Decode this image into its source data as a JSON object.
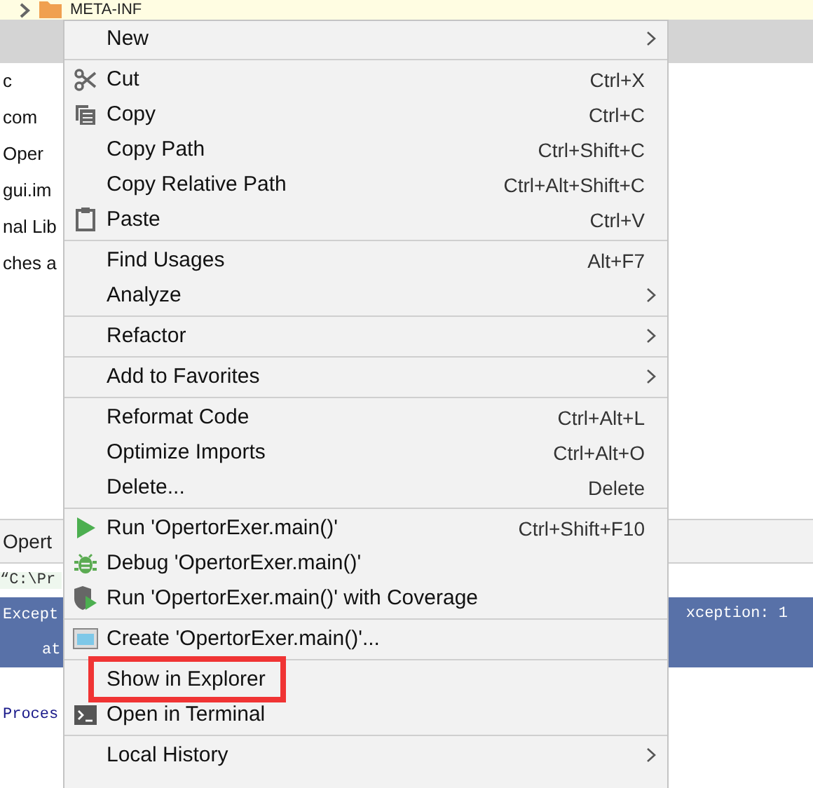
{
  "project_tree": {
    "top_item": "META-INF",
    "items": [
      "c",
      "com",
      "Oper",
      "gui.im",
      "nal Lib",
      "ches a"
    ]
  },
  "run_panel": {
    "tab": "Opert",
    "command_line": "“C:\\Pr",
    "error_lines": [
      "Except",
      "at"
    ],
    "error_tail": "xception: 1",
    "status_line": "Proces"
  },
  "context_menu": [
    {
      "kind": "item",
      "label": "New",
      "submenu": true
    },
    {
      "kind": "separator"
    },
    {
      "kind": "item",
      "label": "Cut",
      "shortcut": "Ctrl+X"
    },
    {
      "kind": "item",
      "label": "Copy",
      "shortcut": "Ctrl+C"
    },
    {
      "kind": "item",
      "label": "Copy Path",
      "shortcut": "Ctrl+Shift+C"
    },
    {
      "kind": "item",
      "label": "Copy Relative Path",
      "shortcut": "Ctrl+Alt+Shift+C"
    },
    {
      "kind": "item",
      "label": "Paste",
      "shortcut": "Ctrl+V"
    },
    {
      "kind": "separator"
    },
    {
      "kind": "item",
      "label": "Find Usages",
      "shortcut": "Alt+F7"
    },
    {
      "kind": "item",
      "label": "Analyze",
      "submenu": true
    },
    {
      "kind": "separator"
    },
    {
      "kind": "item",
      "label": "Refactor",
      "submenu": true
    },
    {
      "kind": "separator"
    },
    {
      "kind": "item",
      "label": "Add to Favorites",
      "submenu": true
    },
    {
      "kind": "separator"
    },
    {
      "kind": "item",
      "label": "Reformat Code",
      "shortcut": "Ctrl+Alt+L"
    },
    {
      "kind": "item",
      "label": "Optimize Imports",
      "shortcut": "Ctrl+Alt+O"
    },
    {
      "kind": "item",
      "label": "Delete...",
      "shortcut": "Delete"
    },
    {
      "kind": "separator"
    },
    {
      "kind": "item",
      "label": "Run 'OpertorExer.main()'",
      "shortcut": "Ctrl+Shift+F10"
    },
    {
      "kind": "item",
      "label": "Debug 'OpertorExer.main()'"
    },
    {
      "kind": "item",
      "label": "Run 'OpertorExer.main()' with Coverage"
    },
    {
      "kind": "separator"
    },
    {
      "kind": "item",
      "label": "Create 'OpertorExer.main()'..."
    },
    {
      "kind": "separator"
    },
    {
      "kind": "item",
      "label": "Show in Explorer",
      "highlighted": true
    },
    {
      "kind": "item",
      "label": "Open in Terminal"
    },
    {
      "kind": "separator"
    },
    {
      "kind": "item",
      "label": "Local History",
      "submenu": true
    }
  ]
}
